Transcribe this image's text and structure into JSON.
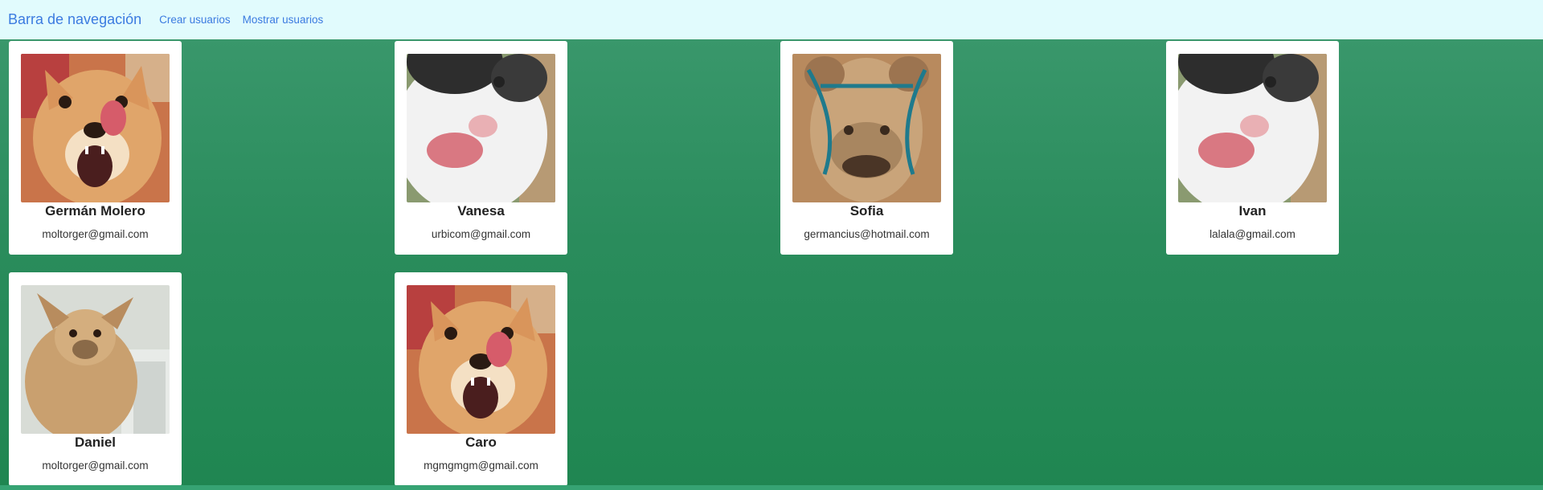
{
  "navbar": {
    "brand": "Barra de navegación",
    "links": [
      "Crear usuarios",
      "Mostrar usuarios"
    ]
  },
  "users": [
    {
      "name": "Germán Molero",
      "email": "moltorger@gmail.com",
      "photo": "dog-tongue-photo"
    },
    {
      "name": "Vanesa",
      "email": "urbicom@gmail.com",
      "photo": "cat-tongue-photo"
    },
    {
      "name": "Sofia",
      "email": "germancius@hotmail.com",
      "photo": "camel-photo"
    },
    {
      "name": "Ivan",
      "email": "lalala@gmail.com",
      "photo": "cat-tongue-photo"
    },
    {
      "name": "Daniel",
      "email": "moltorger@gmail.com",
      "photo": "chihuahua-photo"
    },
    {
      "name": "Caro",
      "email": "mgmgmgm@gmail.com",
      "photo": "dog-tongue-photo"
    }
  ],
  "colors": {
    "navbar_bg": "#e1fbfd",
    "link": "#3b7be0",
    "page_bg": "#2a8f5f",
    "card_bg": "#ffffff"
  }
}
